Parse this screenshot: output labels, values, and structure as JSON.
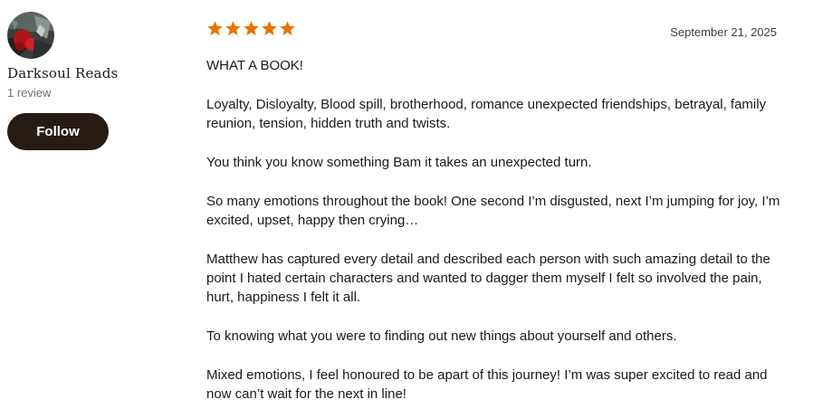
{
  "reviewer": {
    "name": "Darksoul Reads",
    "review_count": "1 review",
    "follow_label": "Follow"
  },
  "review": {
    "rating": 5,
    "rating_color": "#e87400",
    "date": "September 21, 2025",
    "paragraphs": [
      "WHAT A BOOK!",
      "Loyalty, Disloyalty, Blood spill, brotherhood, romance unexpected friendships, betrayal, family reunion, tension, hidden truth and twists.",
      "You think you know something Bam it takes an unexpected turn.",
      "So many emotions throughout the book! One second I’m disgusted, next I’m jumping for joy, I’m excited, upset, happy then crying…",
      "Matthew has captured every detail and described each person with such amazing detail to the point I hated certain characters and wanted to dagger them myself I felt so involved the pain, hurt, happiness I felt it all.",
      "To knowing what you were to finding out new things about yourself and others.",
      "Mixed emotions, I feel honoured to be apart of this journey! I’m was super excited to read and now can’t wait for the next in line!"
    ]
  }
}
